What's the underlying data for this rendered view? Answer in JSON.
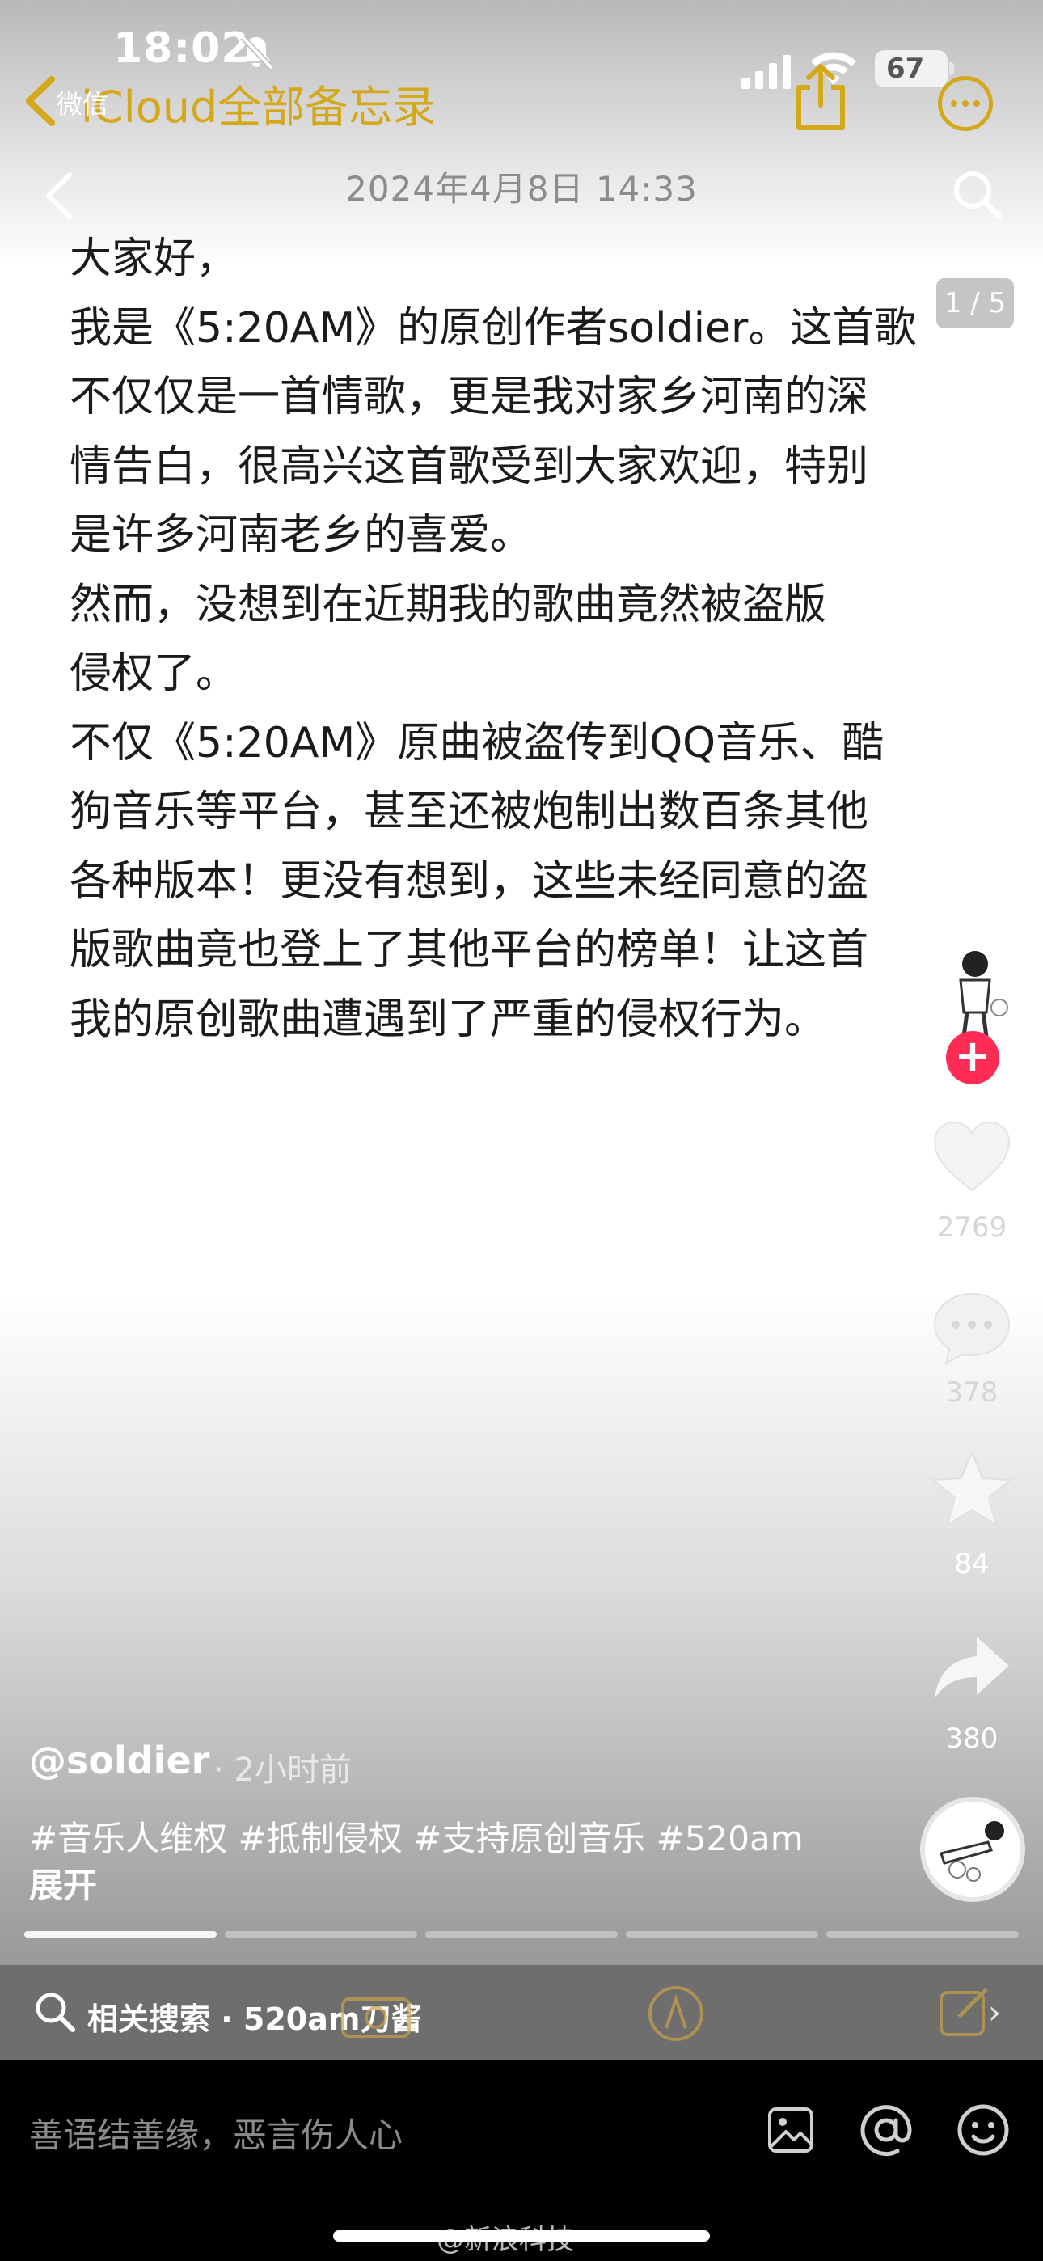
{
  "status_bar": {
    "time": "18:02",
    "battery": "67"
  },
  "notes_header": {
    "back_app": "微信",
    "title": "iCloud全部备忘录",
    "date": "2024年4月8日 14:33",
    "page_indicator": "1 / 5"
  },
  "note": {
    "lines": [
      "大家好，",
      "我是《5:20AM》的原创作者soldier。这首歌",
      "不仅仅是一首情歌，更是我对家乡河南的深",
      "情告白，很高兴这首歌受到大家欢迎，特别",
      "是许多河南老乡的喜爱。",
      "然而，没想到在近期我的歌曲竟然被盗版",
      "侵权了。",
      "不仅《5:20AM》原曲被盗传到QQ音乐、酷",
      "狗音乐等平台，甚至还被炮制出数百条其他",
      "各种版本！更没有想到，这些未经同意的盗",
      "版歌曲竟也登上了其他平台的榜单！让这首",
      "我的原创歌曲遭遇到了严重的侵权行为。"
    ]
  },
  "actions": {
    "like_count": "2769",
    "comment_count": "378",
    "favorite_count": "84",
    "share_count": "380"
  },
  "video": {
    "author": "@soldier",
    "time": "· 2小时前",
    "hashtags": "#音乐人维权 #抵制侵权 #支持原创音乐 #520am",
    "expand": "展开",
    "progress": {
      "segments": 5,
      "active_index": 0
    }
  },
  "related_search": {
    "label": "相关搜索 · 520am刀酱"
  },
  "comment": {
    "placeholder": "善语结善缘，恶言伤人心"
  },
  "watermark": "@新浪科技",
  "colors": {
    "notes_accent": "#d4a81b",
    "follow_red": "#fe2c55"
  }
}
